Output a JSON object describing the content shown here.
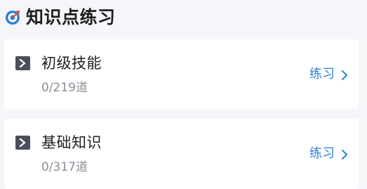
{
  "section": {
    "title": "知识点练习",
    "icon": "target-icon",
    "accent_color": "#2f80d8"
  },
  "items": [
    {
      "title": "初级技能",
      "progress": "0/219道",
      "action_label": "练习"
    },
    {
      "title": "基础知识",
      "progress": "0/317道",
      "action_label": "练习"
    }
  ]
}
